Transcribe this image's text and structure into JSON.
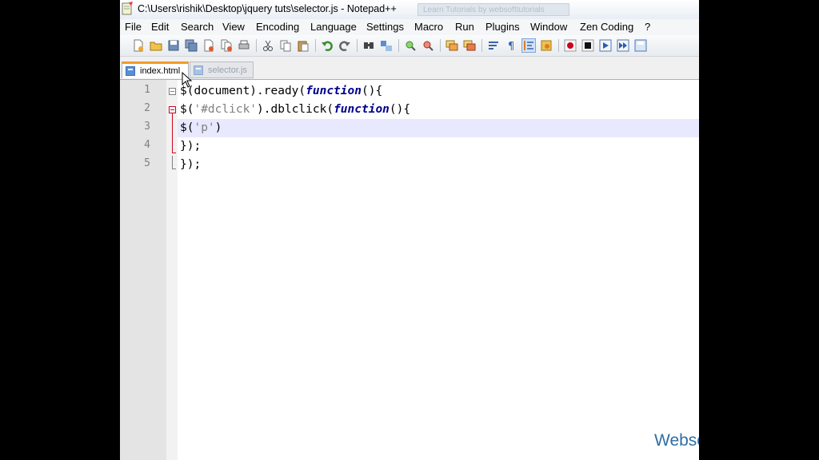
{
  "window": {
    "title": "C:\\Users\\rishik\\Desktop\\jquery tuts\\selector.js - Notepad++",
    "background_window_title": "Learn Tutorials by websofttutorials"
  },
  "menu": {
    "items": [
      "File",
      "Edit",
      "Search",
      "View",
      "Encoding",
      "Language",
      "Settings",
      "Macro",
      "Run",
      "Plugins",
      "Window",
      "Zen Coding",
      "?"
    ]
  },
  "toolbar": {
    "icons": [
      "new-file-icon",
      "open-file-icon",
      "save-icon",
      "save-all-icon",
      "close-icon",
      "close-all-icon",
      "print-icon",
      "cut-icon",
      "copy-icon",
      "paste-icon",
      "undo-icon",
      "redo-icon",
      "find-icon",
      "replace-icon",
      "zoom-in-icon",
      "zoom-out-icon",
      "sync-v-icon",
      "sync-h-icon",
      "word-wrap-icon",
      "show-all-chars-icon",
      "indent-guide-icon",
      "doc-map-icon",
      "record-macro-icon",
      "stop-macro-icon",
      "play-macro-icon",
      "run-multiple-icon",
      "save-macro-icon"
    ]
  },
  "tabs": [
    {
      "label": "index.html",
      "active": true
    },
    {
      "label": "selector.js",
      "active": false
    }
  ],
  "editor": {
    "line_numbers": [
      "1",
      "2",
      "3",
      "4",
      "5"
    ],
    "lines": [
      {
        "t1": "$(document).ready(",
        "kw": "function",
        "t2": "(){"
      },
      {
        "t1": "$(",
        "s": "'#dclick'",
        "t2": ").dblclick(",
        "kw": "function",
        "t3": "(){"
      },
      {
        "t1": "$(",
        "s": "'p'",
        "t2": ")"
      },
      {
        "t1": "});"
      },
      {
        "t1": "});"
      }
    ]
  },
  "watermark": "Websofttutorials.com",
  "colors": {
    "keyword": "#00008b",
    "string": "#808080",
    "active_tab_accent": "#f29b27",
    "current_line": "#e8e8ff",
    "watermark": "#2e6da4"
  }
}
